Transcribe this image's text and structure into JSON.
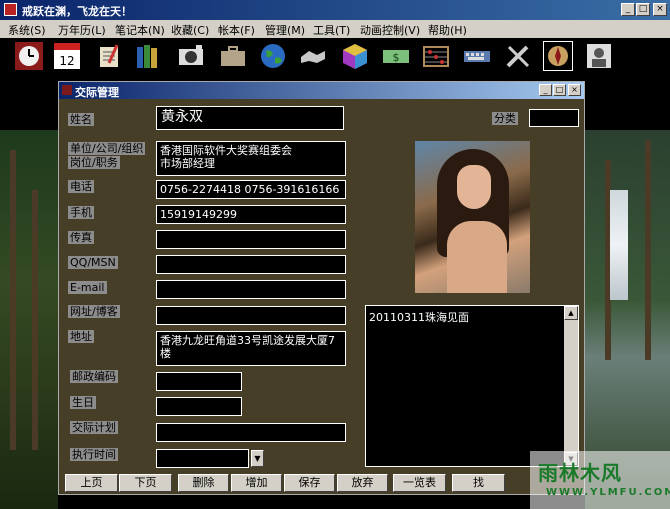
{
  "window": {
    "title": "戒跃在渊，飞龙在天！"
  },
  "menu": {
    "items": [
      "系统(S)",
      "万年历(L)",
      "笔记本(N)",
      "收藏(C)",
      "帐本(F)",
      "管理(M)",
      "工具(T)",
      "动画控制(V)",
      "帮助(H)"
    ]
  },
  "toolbar": {
    "icons": [
      "clock-icon",
      "calendar-icon",
      "notebook-icon",
      "books-icon",
      "camera-icon",
      "briefcase-icon",
      "globe-icon",
      "handshake-icon",
      "cube-icon",
      "money-icon",
      "abacus-icon",
      "keyboard-icon",
      "tools-icon",
      "compass-icon",
      "portrait-icon"
    ]
  },
  "dialog": {
    "title": "交际管理",
    "labels": {
      "name": "姓名",
      "category": "分类",
      "org": "单位/公司/组织",
      "position": "岗位/职务",
      "phone": "电话",
      "mobile": "手机",
      "fax": "传真",
      "qq": "QQ/MSN",
      "email": "E-mail",
      "website": "网址/博客",
      "address": "地址",
      "postcode": "邮政编码",
      "birthday": "生日",
      "plan": "交际计划",
      "exec_time": "执行时间"
    },
    "values": {
      "name": "黄永双",
      "category": "",
      "org": "香港国际软件大奖赛组委会\n市场部经理",
      "phone": "0756-2274418 0756-391616166",
      "mobile": "15919149299",
      "fax": "",
      "qq": "",
      "email": "",
      "website": "",
      "address": "香港九龙旺角道33号凯途发展大厦7楼",
      "postcode": "",
      "birthday": "",
      "plan": "",
      "exec_time": ""
    },
    "memo": "20110311珠海见面",
    "buttons": [
      "上页",
      "下页",
      "删除",
      "增加",
      "保存",
      "放弃",
      "一览表",
      "找"
    ]
  },
  "watermark": {
    "name": "雨林木风",
    "url": "WWW.YLMFU.COM"
  },
  "colors": {
    "dialog_bg": "#473e28",
    "label_bg": "#8c8c8c",
    "field_bg": "#000000",
    "titlebar": "#0a246a"
  }
}
